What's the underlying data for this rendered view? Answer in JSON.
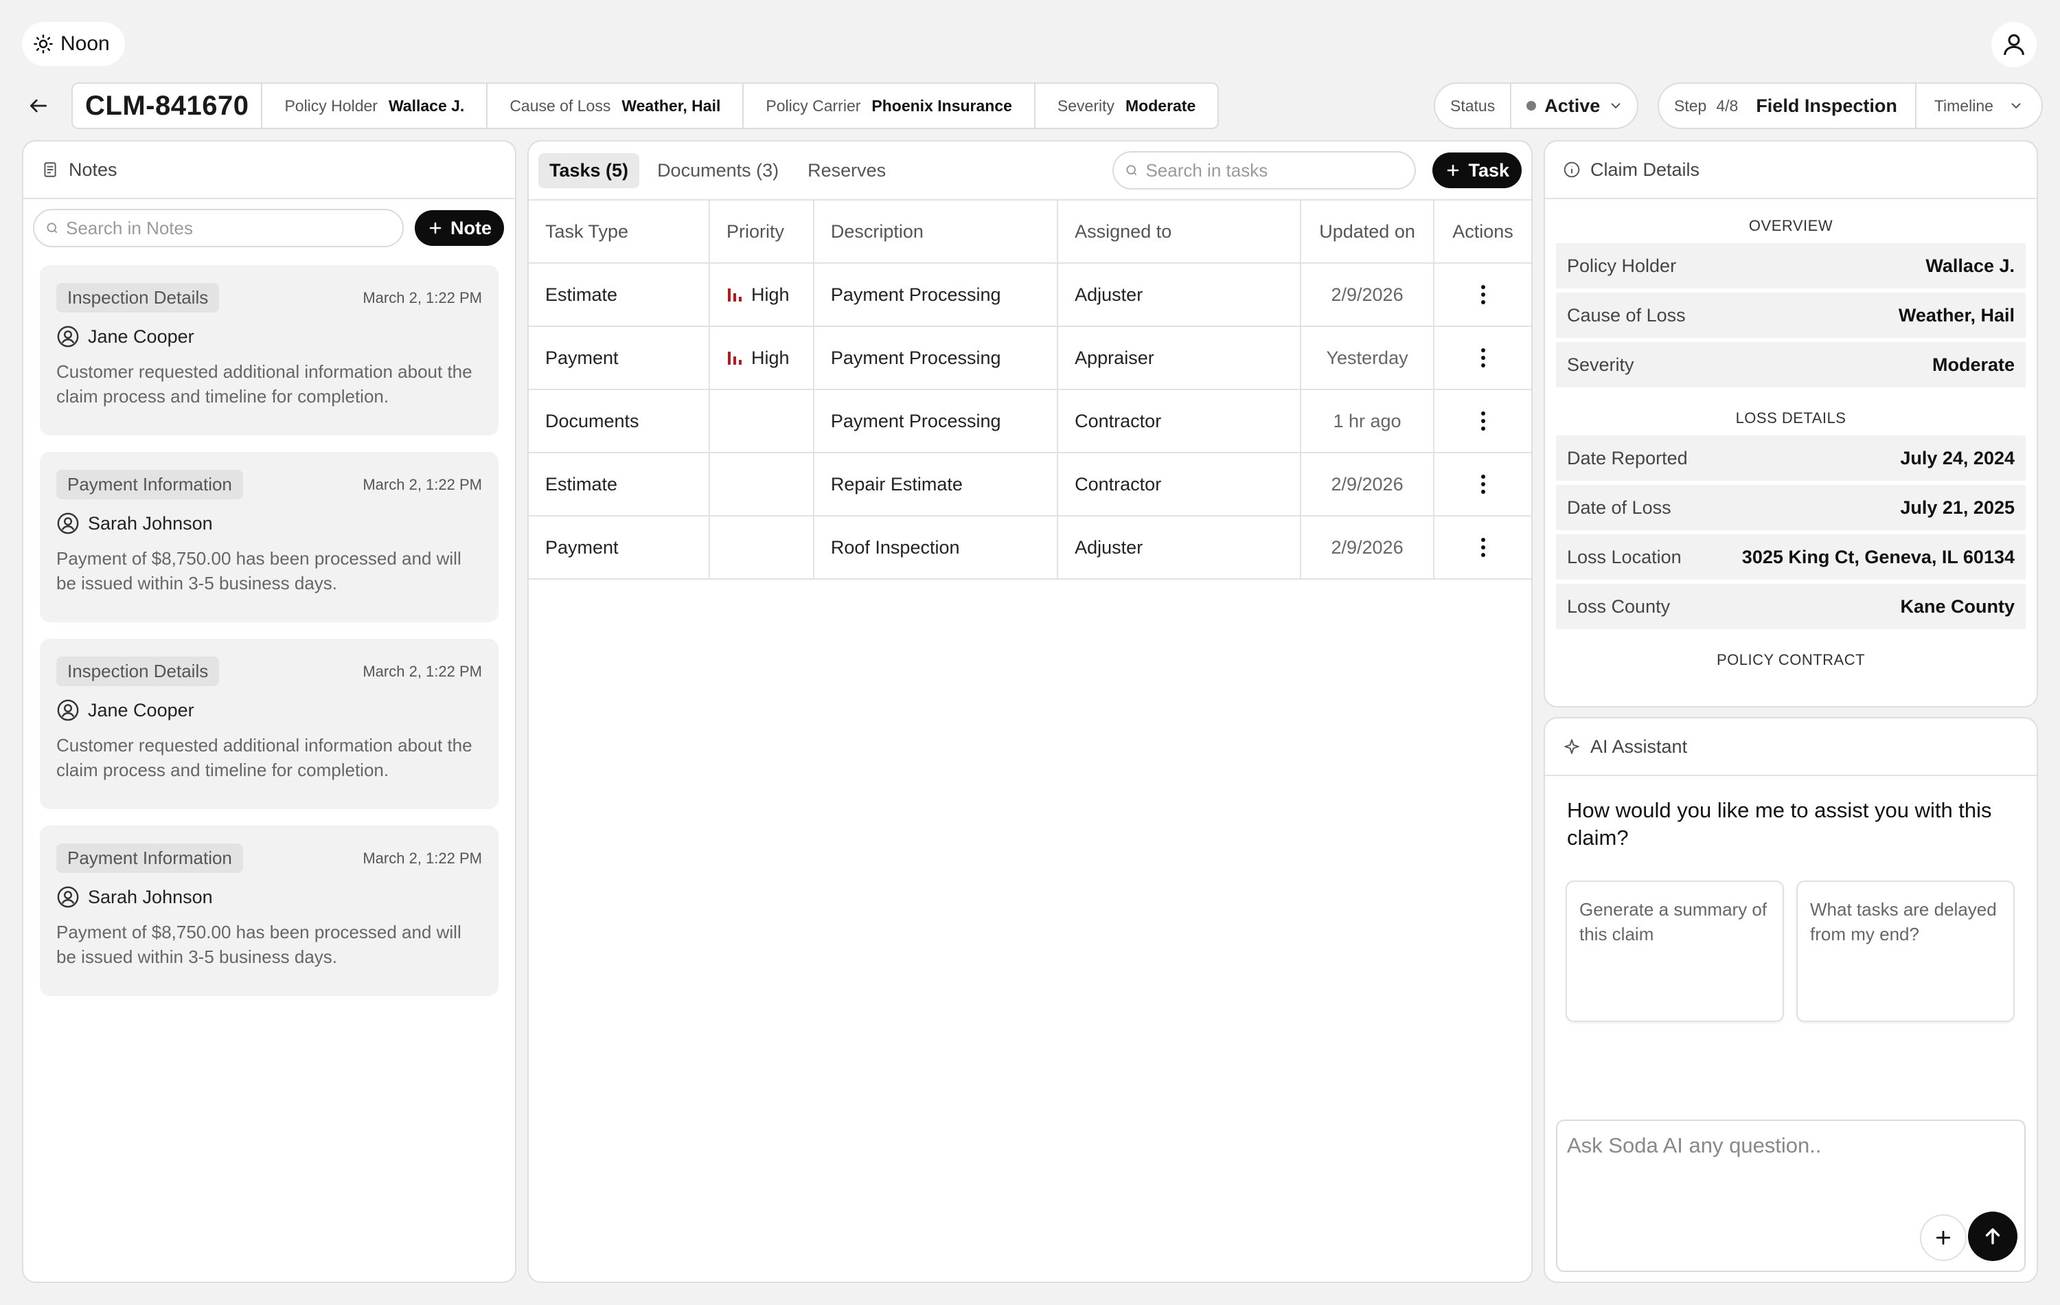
{
  "app": {
    "name": "Noon"
  },
  "claim": {
    "id": "CLM-841670",
    "fields": [
      {
        "label": "Policy Holder",
        "value": "Wallace  J."
      },
      {
        "label": "Cause of Loss",
        "value": "Weather, Hail"
      },
      {
        "label": "Policy Carrier",
        "value": "Phoenix Insurance"
      },
      {
        "label": "Severity",
        "value": "Moderate"
      }
    ]
  },
  "status": {
    "label": "Status",
    "value": "Active",
    "dot_color": "#7a7a7a"
  },
  "step": {
    "label": "Step",
    "count": "4/8",
    "name": "Field Inspection",
    "timeline_label": "Timeline"
  },
  "notes": {
    "title": "Notes",
    "search_placeholder": "Search in Notes",
    "add_label": "Note",
    "items": [
      {
        "tag": "Inspection Details",
        "date": "March 2, 1:22 PM",
        "author": "Jane Cooper",
        "body": "Customer requested additional information about the claim process and timeline for completion."
      },
      {
        "tag": "Payment Information",
        "date": "March 2, 1:22 PM",
        "author": "Sarah Johnson",
        "body": "Payment of $8,750.00 has been processed and will be issued within 3-5 business days."
      },
      {
        "tag": "Inspection Details",
        "date": "March 2, 1:22 PM",
        "author": "Jane Cooper",
        "body": "Customer requested additional information about the claim process and timeline for completion."
      },
      {
        "tag": "Payment Information",
        "date": "March 2, 1:22 PM",
        "author": "Sarah Johnson",
        "body": "Payment of $8,750.00 has been processed and will be issued within 3-5 business days."
      }
    ]
  },
  "tasks": {
    "tabs": [
      "Tasks (5)",
      "Documents (3)",
      "Reserves"
    ],
    "search_placeholder": "Search in tasks",
    "add_label": "Task",
    "columns": [
      "Task Type",
      "Priority",
      "Description",
      "Assigned to",
      "Updated on",
      "Actions"
    ],
    "priority_color": "#b01c1c",
    "rows": [
      {
        "type": "Estimate",
        "priority": "High",
        "description": "Payment Processing",
        "assigned": "Adjuster",
        "updated": "2/9/2026"
      },
      {
        "type": "Payment",
        "priority": "High",
        "description": "Payment Processing",
        "assigned": "Appraiser",
        "updated": "Yesterday"
      },
      {
        "type": "Documents",
        "priority": "",
        "description": "Payment Processing",
        "assigned": "Contractor",
        "updated": "1 hr ago"
      },
      {
        "type": "Estimate",
        "priority": "",
        "description": "Repair Estimate",
        "assigned": "Contractor",
        "updated": "2/9/2026"
      },
      {
        "type": "Payment",
        "priority": "",
        "description": "Roof Inspection",
        "assigned": "Adjuster",
        "updated": "2/9/2026"
      }
    ]
  },
  "details": {
    "title": "Claim Details",
    "overview_title": "OVERVIEW",
    "overview": [
      {
        "label": "Policy Holder",
        "value": "Wallace  J."
      },
      {
        "label": "Cause of Loss",
        "value": "Weather, Hail"
      },
      {
        "label": "Severity",
        "value": "Moderate"
      }
    ],
    "loss_title": "LOSS DETAILS",
    "loss": [
      {
        "label": "Date Reported",
        "value": "July 24, 2024"
      },
      {
        "label": "Date of Loss",
        "value": "July 21, 2025"
      },
      {
        "label": "Loss Location",
        "value": "3025 King Ct, Geneva, IL 60134"
      },
      {
        "label": "Loss County",
        "value": "Kane County"
      }
    ],
    "contract_title": "POLICY CONTRACT"
  },
  "ai": {
    "title": "AI Assistant",
    "question": "How would you like me to assist you with this claim?",
    "suggestions": [
      "Generate a summary of this claim",
      "What tasks are delayed from my end?"
    ],
    "input_placeholder": "Ask Soda AI any question.."
  }
}
